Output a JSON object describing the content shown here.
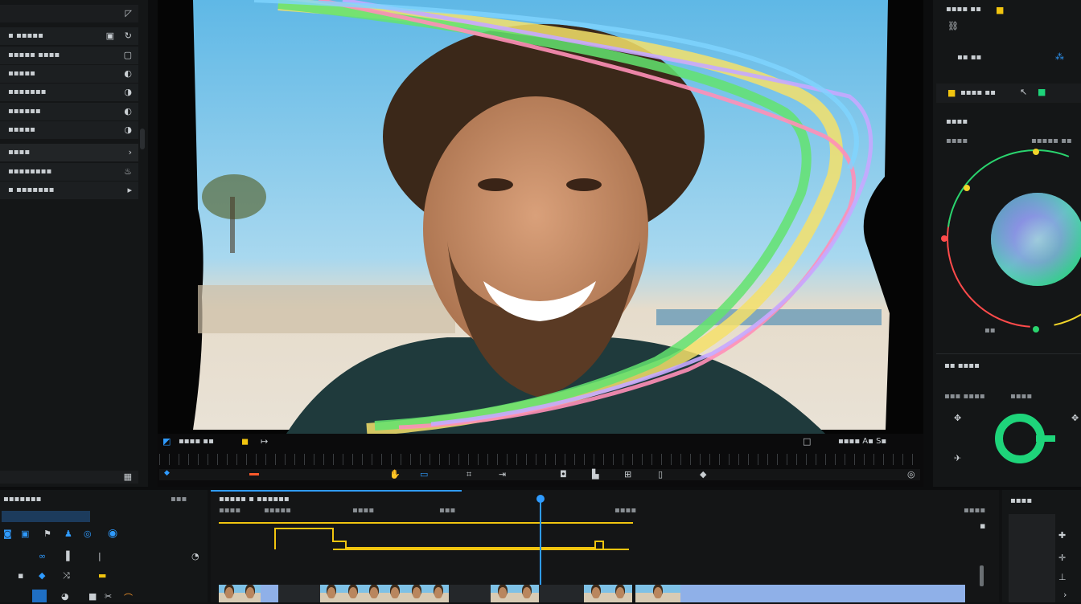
{
  "left_panel": {
    "header": "",
    "rows": [
      {
        "label": "▪ ▪▪▪▪▪",
        "icon": "square-dot-icon"
      },
      {
        "label": "▪▪▪▪▪ ▪▪▪▪",
        "icon": "cube-icon"
      },
      {
        "label": "▪▪▪▪▪",
        "icon": "globe-icon"
      },
      {
        "label": "▪▪▪▪▪▪▪",
        "icon": "globe-icon"
      },
      {
        "label": "▪▪▪▪▪▪",
        "icon": "globe-icon"
      },
      {
        "label": "▪▪▪▪▪",
        "icon": "globe-icon"
      },
      {
        "label": "▪▪▪▪",
        "icon": "chevron-icon"
      },
      {
        "label": "▪▪▪▪▪▪▪▪",
        "icon": "flame-icon"
      },
      {
        "label": "▪ ▪▪▪▪▪▪▪",
        "icon": "play-icon"
      }
    ]
  },
  "viewer": {
    "toolbar_left_text": "▪▪▪▪ ▪▪",
    "toolbar_right_text": "▪▪▪▪ A▪ S▪"
  },
  "right_panel": {
    "top_label": "▪▪▪▪ ▪▪",
    "section1_label": "▪▪ ▪▪",
    "section2_label": "▪▪▪▪ ▪▪",
    "color_section_title": "▪▪▪▪",
    "color_sub_left": "▪▪▪▪",
    "color_sub_right": "▪▪▪▪▪ ▪▪",
    "wheel_bottom_label": "▪▪",
    "lower_label": "▪▪ ▪▪▪▪",
    "bottom_left_label": "▪▪▪ ▪▪▪▪",
    "bottom_right_label": "▪▪▪▪"
  },
  "timeline": {
    "panel_title": "▪▪▪▪▪▪▪",
    "panel_title_right": "▪▪▪",
    "track_header": "▪▪▪▪▪ ▪ ▪▪▪▪▪▪",
    "right_panel_title": "▪▪▪▪",
    "timecodes": [
      "▪▪▪▪",
      "▪▪▪▪▪",
      "▪▪▪▪",
      "▪▪▪",
      "▪▪▪▪"
    ]
  },
  "colors": {
    "accent_blue": "#2f9bff",
    "accent_yellow": "#f1c40f",
    "accent_green": "#1ed47a"
  }
}
